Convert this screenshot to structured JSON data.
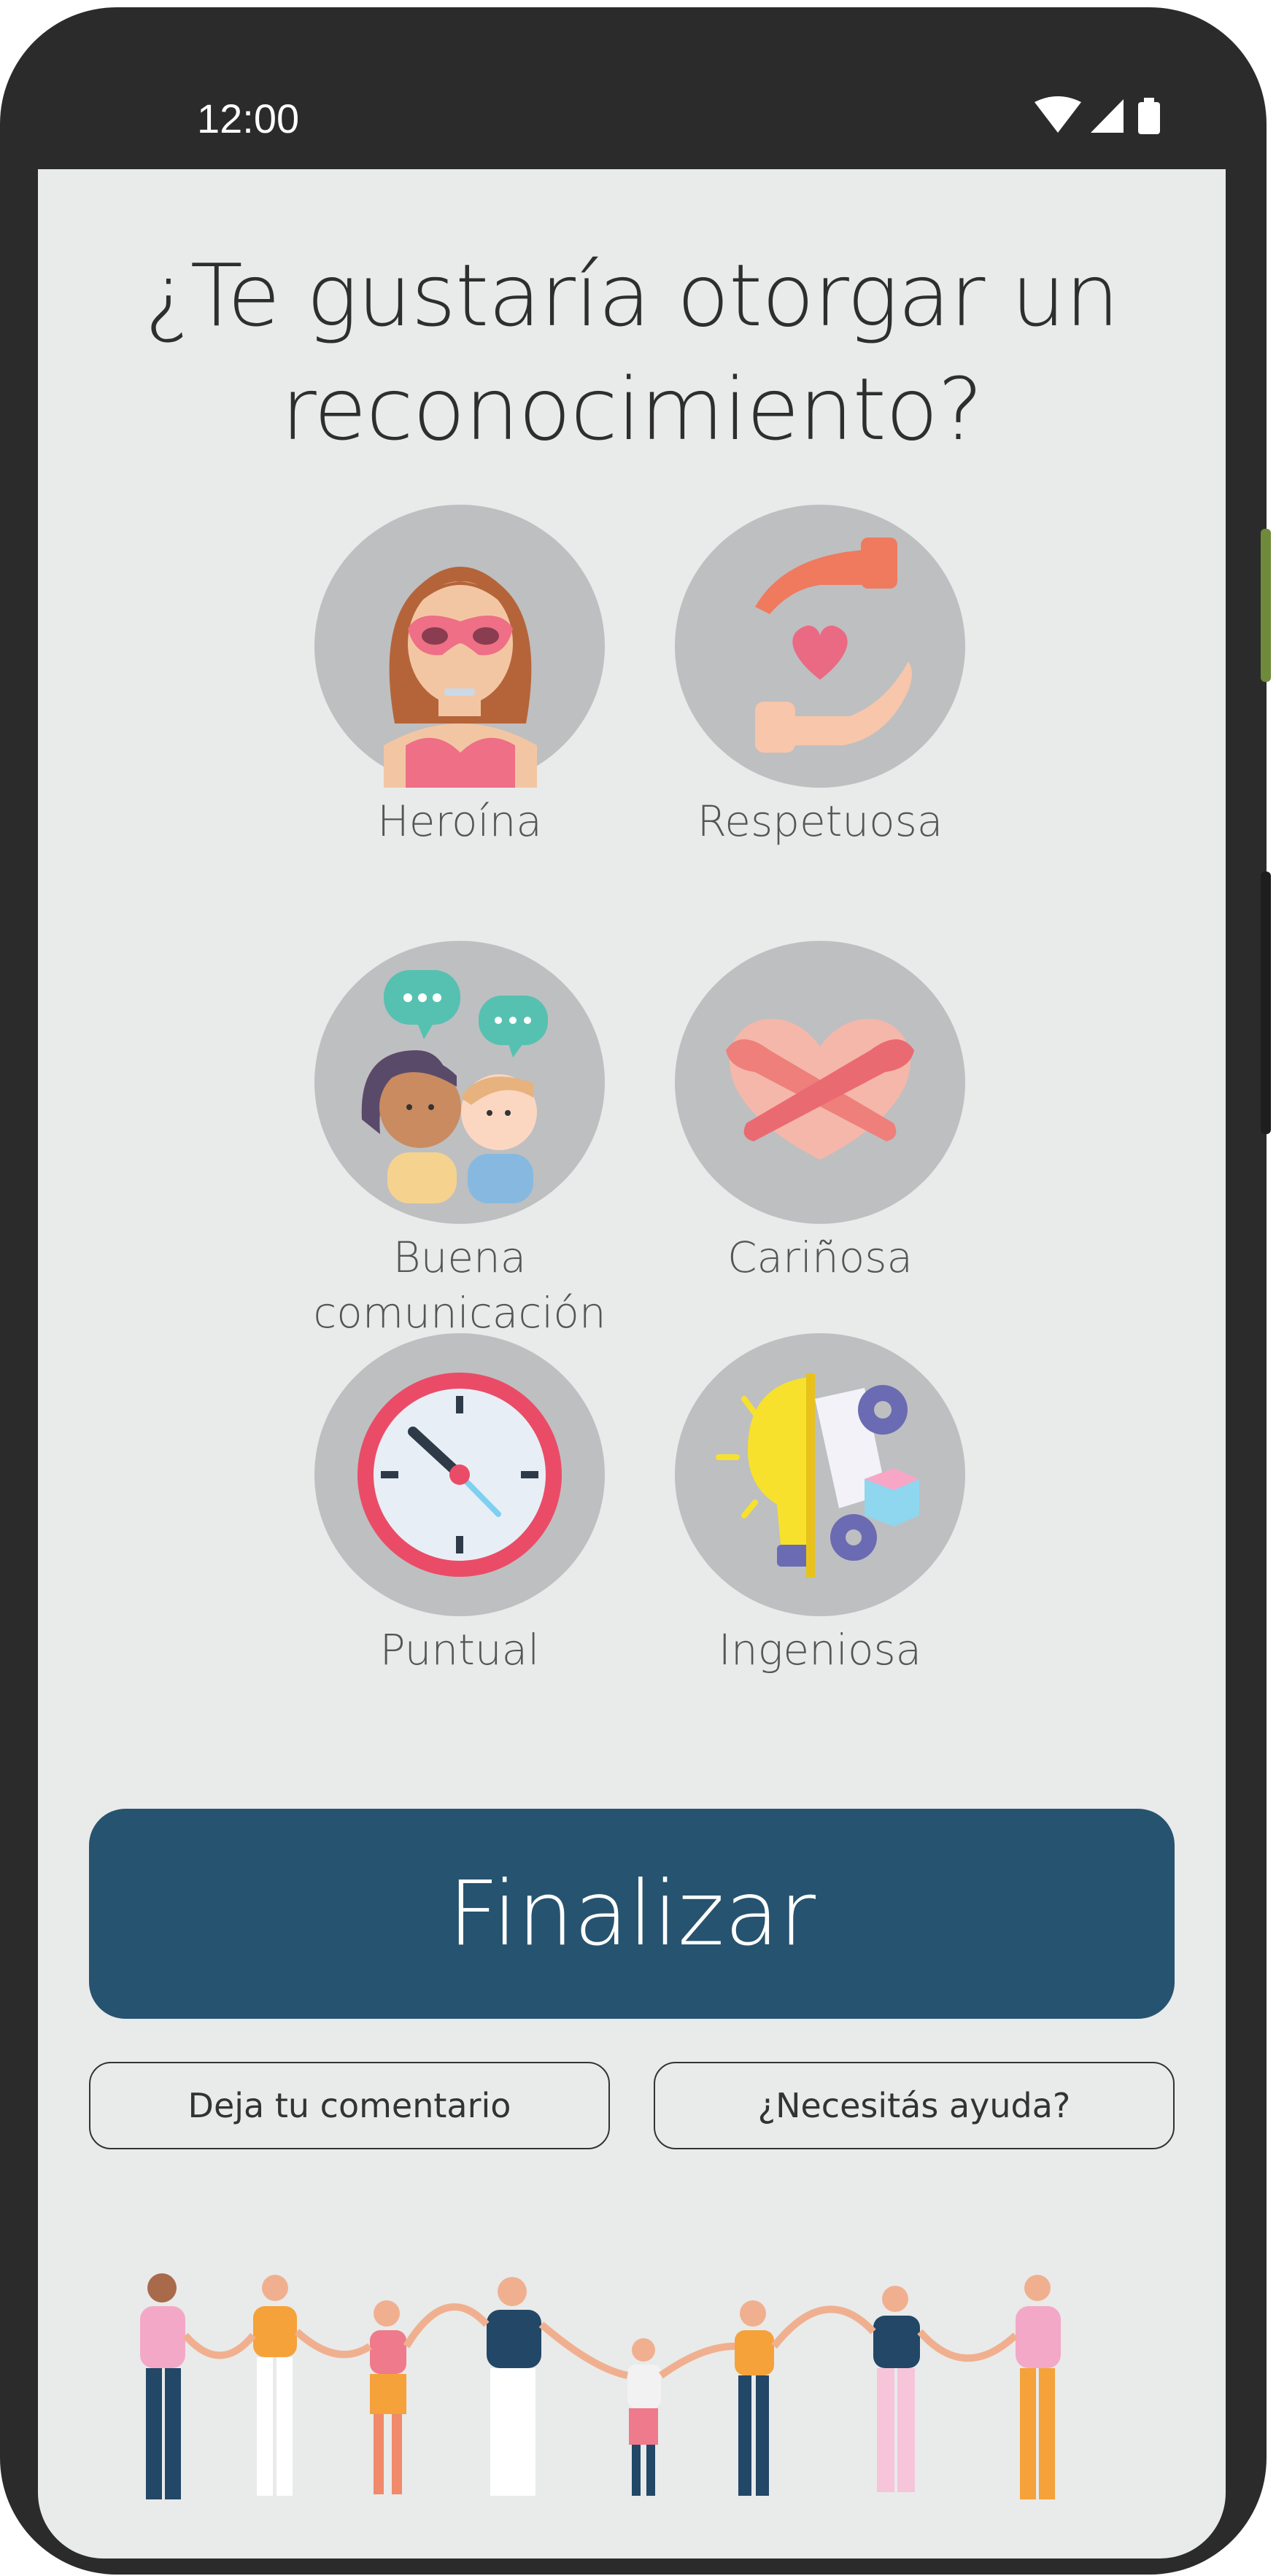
{
  "status_bar": {
    "time": "12:00",
    "icons": [
      "wifi-icon",
      "signal-icon",
      "battery-icon"
    ]
  },
  "title": {
    "line1": "¿Te gustaría otorgar un",
    "line2": "reconocimiento?"
  },
  "badges": [
    {
      "label": "Heroína",
      "icon": "superhero-woman-icon"
    },
    {
      "label": "Respetuosa",
      "icon": "hands-heart-icon"
    },
    {
      "label": "Buena comunicación",
      "label_line1": "Buena",
      "label_line2": "comunicación",
      "icon": "people-chat-icon"
    },
    {
      "label": "Cariñosa",
      "icon": "hugging-heart-icon"
    },
    {
      "label": "Puntual",
      "icon": "clock-icon"
    },
    {
      "label": "Ingeniosa",
      "icon": "lightbulb-gears-icon"
    }
  ],
  "actions": {
    "finalizar_label": "Finalizar",
    "comment_label": "Deja tu comentario",
    "help_label": "¿Necesitás ayuda?"
  },
  "illustration": {
    "icon": "diverse-people-holding-hands-illustration"
  },
  "colors": {
    "primary": "#26536f",
    "screen_bg": "#e9eaea",
    "badge_bg": "#bebfc1",
    "frame": "#2b2b2b"
  }
}
